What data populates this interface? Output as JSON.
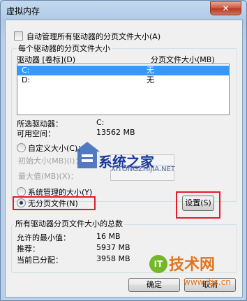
{
  "window": {
    "title": "虚拟内存",
    "close_glyph": "✕"
  },
  "auto_manage_label": "自动管理所有驱动器的分页文件大小(A)",
  "per_drive_group_label": "每个驱动器的分页文件大小",
  "list": {
    "col_drive": "驱动器 [卷标](D)",
    "col_size": "分页文件大小(MB)",
    "rows": [
      {
        "drive": "C:",
        "size": "无"
      },
      {
        "drive": "D:",
        "size": "无"
      }
    ]
  },
  "selected_drive": {
    "label": "所选驱动器：",
    "value": "C:"
  },
  "free_space": {
    "label": "可用空间：",
    "value": "13562 MB"
  },
  "custom_size": {
    "label": "自定义大小(C)：",
    "initial_label": "初始大小(MB)(I)：",
    "max_label": "最大值(MB)(X)："
  },
  "system_managed_label": "系统管理的大小(Y)",
  "no_paging_label": "无分页文件(N)",
  "set_button": "设置(S)",
  "totals": {
    "group_label": "所有驱动器分页文件大小的总数",
    "min_label": "允许的最小值：",
    "min_value": "16 MB",
    "rec_label": "推荐：",
    "rec_value": "5937 MB",
    "cur_label": "当前已分配：",
    "cur_value": "3958 MB"
  },
  "ok_button": "确定",
  "cancel_button": "取消",
  "watermark": {
    "brand": "系统之家",
    "brand_url": "XITONGZHIJIA.NET",
    "site_name": "技术网",
    "site_url": "www.itjs.cn",
    "logo_text": "IT"
  },
  "colors": {
    "selection": "#3399ff",
    "highlight_box": "#e21d2a"
  }
}
